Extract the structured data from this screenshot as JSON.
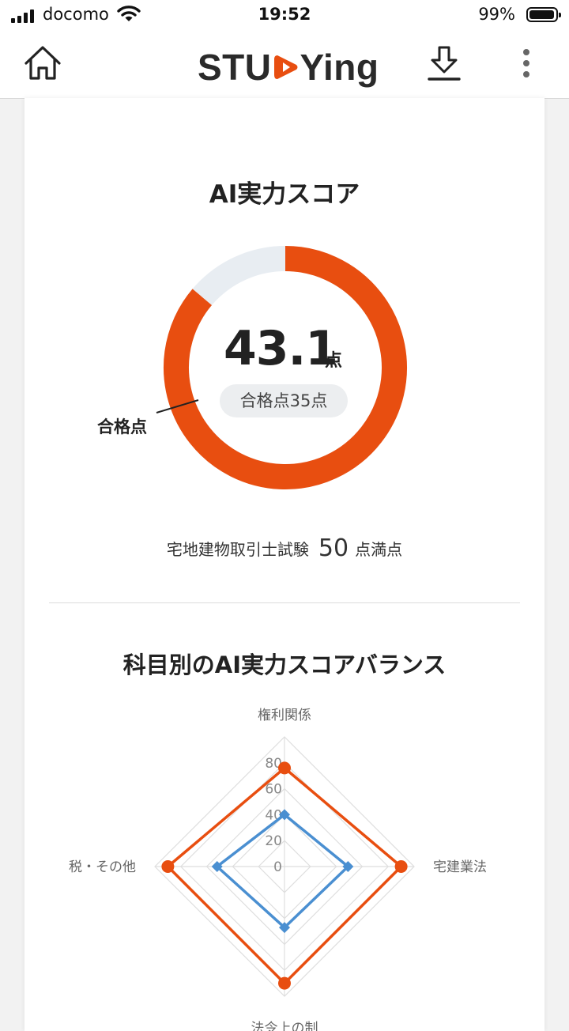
{
  "status_bar": {
    "carrier": "docomo",
    "time": "19:52",
    "battery": "99%",
    "battery_level": 0.99
  },
  "header": {
    "logo_prefix": "STU",
    "logo_suffix": "Ying",
    "brand_color": "#e84e10",
    "icons": [
      "home-icon",
      "download-icon",
      "more-vertical-icon"
    ]
  },
  "score": {
    "title": "AI実力スコア",
    "value": "43.1",
    "value_num": 43.1,
    "unit": "点",
    "max_num": 50,
    "pass_score_num": 35,
    "pass_pill": "合格点35点",
    "pass_label": "合格点",
    "exam_name": "宅地建物取引士試験",
    "max_score": "50",
    "max_suffix": "点満点",
    "colors": {
      "fill": "#e84e10",
      "track": "#e8edf2"
    }
  },
  "balance": {
    "title": "科目別のAI実力スコアバランス"
  },
  "chart_data": {
    "type": "radar",
    "axes": [
      "権利関係",
      "宅建業法",
      "法令上の制限",
      "税・その他"
    ],
    "axis_labels_visible": [
      "権利関係",
      "宅建業法",
      "法令上の制",
      "税・その他"
    ],
    "ticks": [
      "80",
      "60",
      "40",
      "20",
      "0"
    ],
    "rlim": [
      0,
      100
    ],
    "series": [
      {
        "values": [
          76,
          90,
          90,
          90
        ],
        "color": "#e84e10",
        "marker": "circle"
      },
      {
        "values": [
          40,
          49,
          47,
          52
        ],
        "color": "#4a8fd1",
        "marker": "diamond"
      }
    ]
  }
}
